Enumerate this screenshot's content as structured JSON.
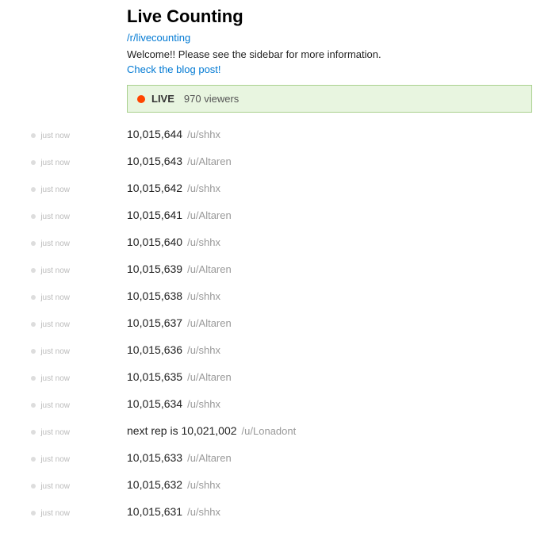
{
  "header": {
    "title": "Live Counting",
    "subreddit": "/r/livecounting",
    "welcome": "Welcome!! Please see the sidebar for more information.",
    "blog_link": "Check the blog post!"
  },
  "live_status": {
    "label": "LIVE",
    "viewers": "970 viewers"
  },
  "entries": [
    {
      "timestamp": "just now",
      "text": "10,015,644",
      "user": "/u/shhx"
    },
    {
      "timestamp": "just now",
      "text": "10,015,643",
      "user": "/u/Altaren"
    },
    {
      "timestamp": "just now",
      "text": "10,015,642",
      "user": "/u/shhx"
    },
    {
      "timestamp": "just now",
      "text": "10,015,641",
      "user": "/u/Altaren"
    },
    {
      "timestamp": "just now",
      "text": "10,015,640",
      "user": "/u/shhx"
    },
    {
      "timestamp": "just now",
      "text": "10,015,639",
      "user": "/u/Altaren"
    },
    {
      "timestamp": "just now",
      "text": "10,015,638",
      "user": "/u/shhx"
    },
    {
      "timestamp": "just now",
      "text": "10,015,637",
      "user": "/u/Altaren"
    },
    {
      "timestamp": "just now",
      "text": "10,015,636",
      "user": "/u/shhx"
    },
    {
      "timestamp": "just now",
      "text": "10,015,635",
      "user": "/u/Altaren"
    },
    {
      "timestamp": "just now",
      "text": "10,015,634",
      "user": "/u/shhx"
    },
    {
      "timestamp": "just now",
      "text": "next rep is 10,021,002",
      "user": "/u/Lonadont"
    },
    {
      "timestamp": "just now",
      "text": "10,015,633",
      "user": "/u/Altaren"
    },
    {
      "timestamp": "just now",
      "text": "10,015,632",
      "user": "/u/shhx"
    },
    {
      "timestamp": "just now",
      "text": "10,015,631",
      "user": "/u/shhx"
    }
  ]
}
